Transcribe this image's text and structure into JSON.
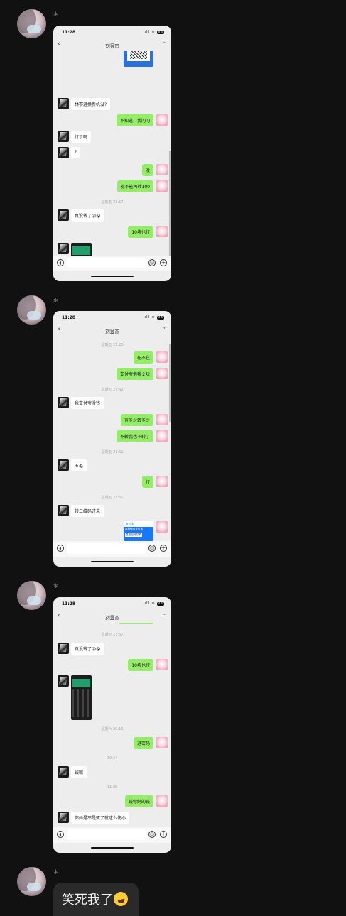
{
  "post_marker": "*",
  "screens": [
    {
      "status_time": "11:28",
      "battery": "84",
      "back_icon": "chevron-left-icon",
      "title": "刘昱杰",
      "more_icon": "ellipsis-icon",
      "messages": [
        {
          "from": "other",
          "text": "林寥涯换新机没?"
        },
        {
          "from": "self",
          "text": "不知道，我问问"
        },
        {
          "from": "other",
          "text": "行了吗"
        },
        {
          "from": "other",
          "text": "?"
        },
        {
          "from": "self",
          "text": "没"
        },
        {
          "from": "self",
          "text": "能不能再转100"
        },
        {
          "time": "星期五 21:57"
        },
        {
          "from": "other",
          "text": "真没钱了😜😰"
        },
        {
          "from": "self",
          "text": "10块也行"
        }
      ]
    },
    {
      "status_time": "11:28",
      "battery": "84",
      "title": "刘昱杰",
      "messages": [
        {
          "time": "星期五 21:23"
        },
        {
          "from": "self",
          "text": "在不在"
        },
        {
          "from": "self",
          "text": "支付宝借我２块"
        },
        {
          "time": "星期五 21:42"
        },
        {
          "from": "other",
          "text": "我支付宝没钱"
        },
        {
          "from": "self",
          "text": "有多少转多少"
        },
        {
          "from": "self",
          "text": "不转我也不转了"
        },
        {
          "time": "星期五 21:51"
        },
        {
          "from": "other",
          "text": "五毛"
        },
        {
          "from": "self",
          "text": "行"
        },
        {
          "time": "星期五 21:52"
        },
        {
          "from": "other",
          "text": "转二维码过来"
        }
      ],
      "pay_card": {
        "header": "支付宝",
        "line1": "推荐使用支付宝",
        "line2": "直接扫码付款"
      }
    },
    {
      "status_time": "11:28",
      "battery": "84",
      "title": "刘昱杰",
      "messages": [
        {
          "time": "星期五 21:57"
        },
        {
          "from": "other",
          "text": "真没钱了😜😰"
        },
        {
          "from": "self",
          "text": "10块也行"
        },
        {
          "time": "星期六 20:16"
        },
        {
          "from": "self",
          "text": "退密码"
        },
        {
          "time": "10:34"
        },
        {
          "from": "other",
          "text": "钱呢"
        },
        {
          "time": "11:25"
        },
        {
          "from": "self",
          "text": "钱你妈的钱"
        },
        {
          "from": "other",
          "text": "你妈是不是死了就这么伤心"
        }
      ]
    }
  ],
  "final_message": {
    "text": "笑死我了",
    "emoji": "rolling-on-floor-laughing-icon"
  },
  "input_icons": {
    "voice": "voice-icon",
    "emoji": "emoji-icon",
    "plus": "plus-icon"
  }
}
